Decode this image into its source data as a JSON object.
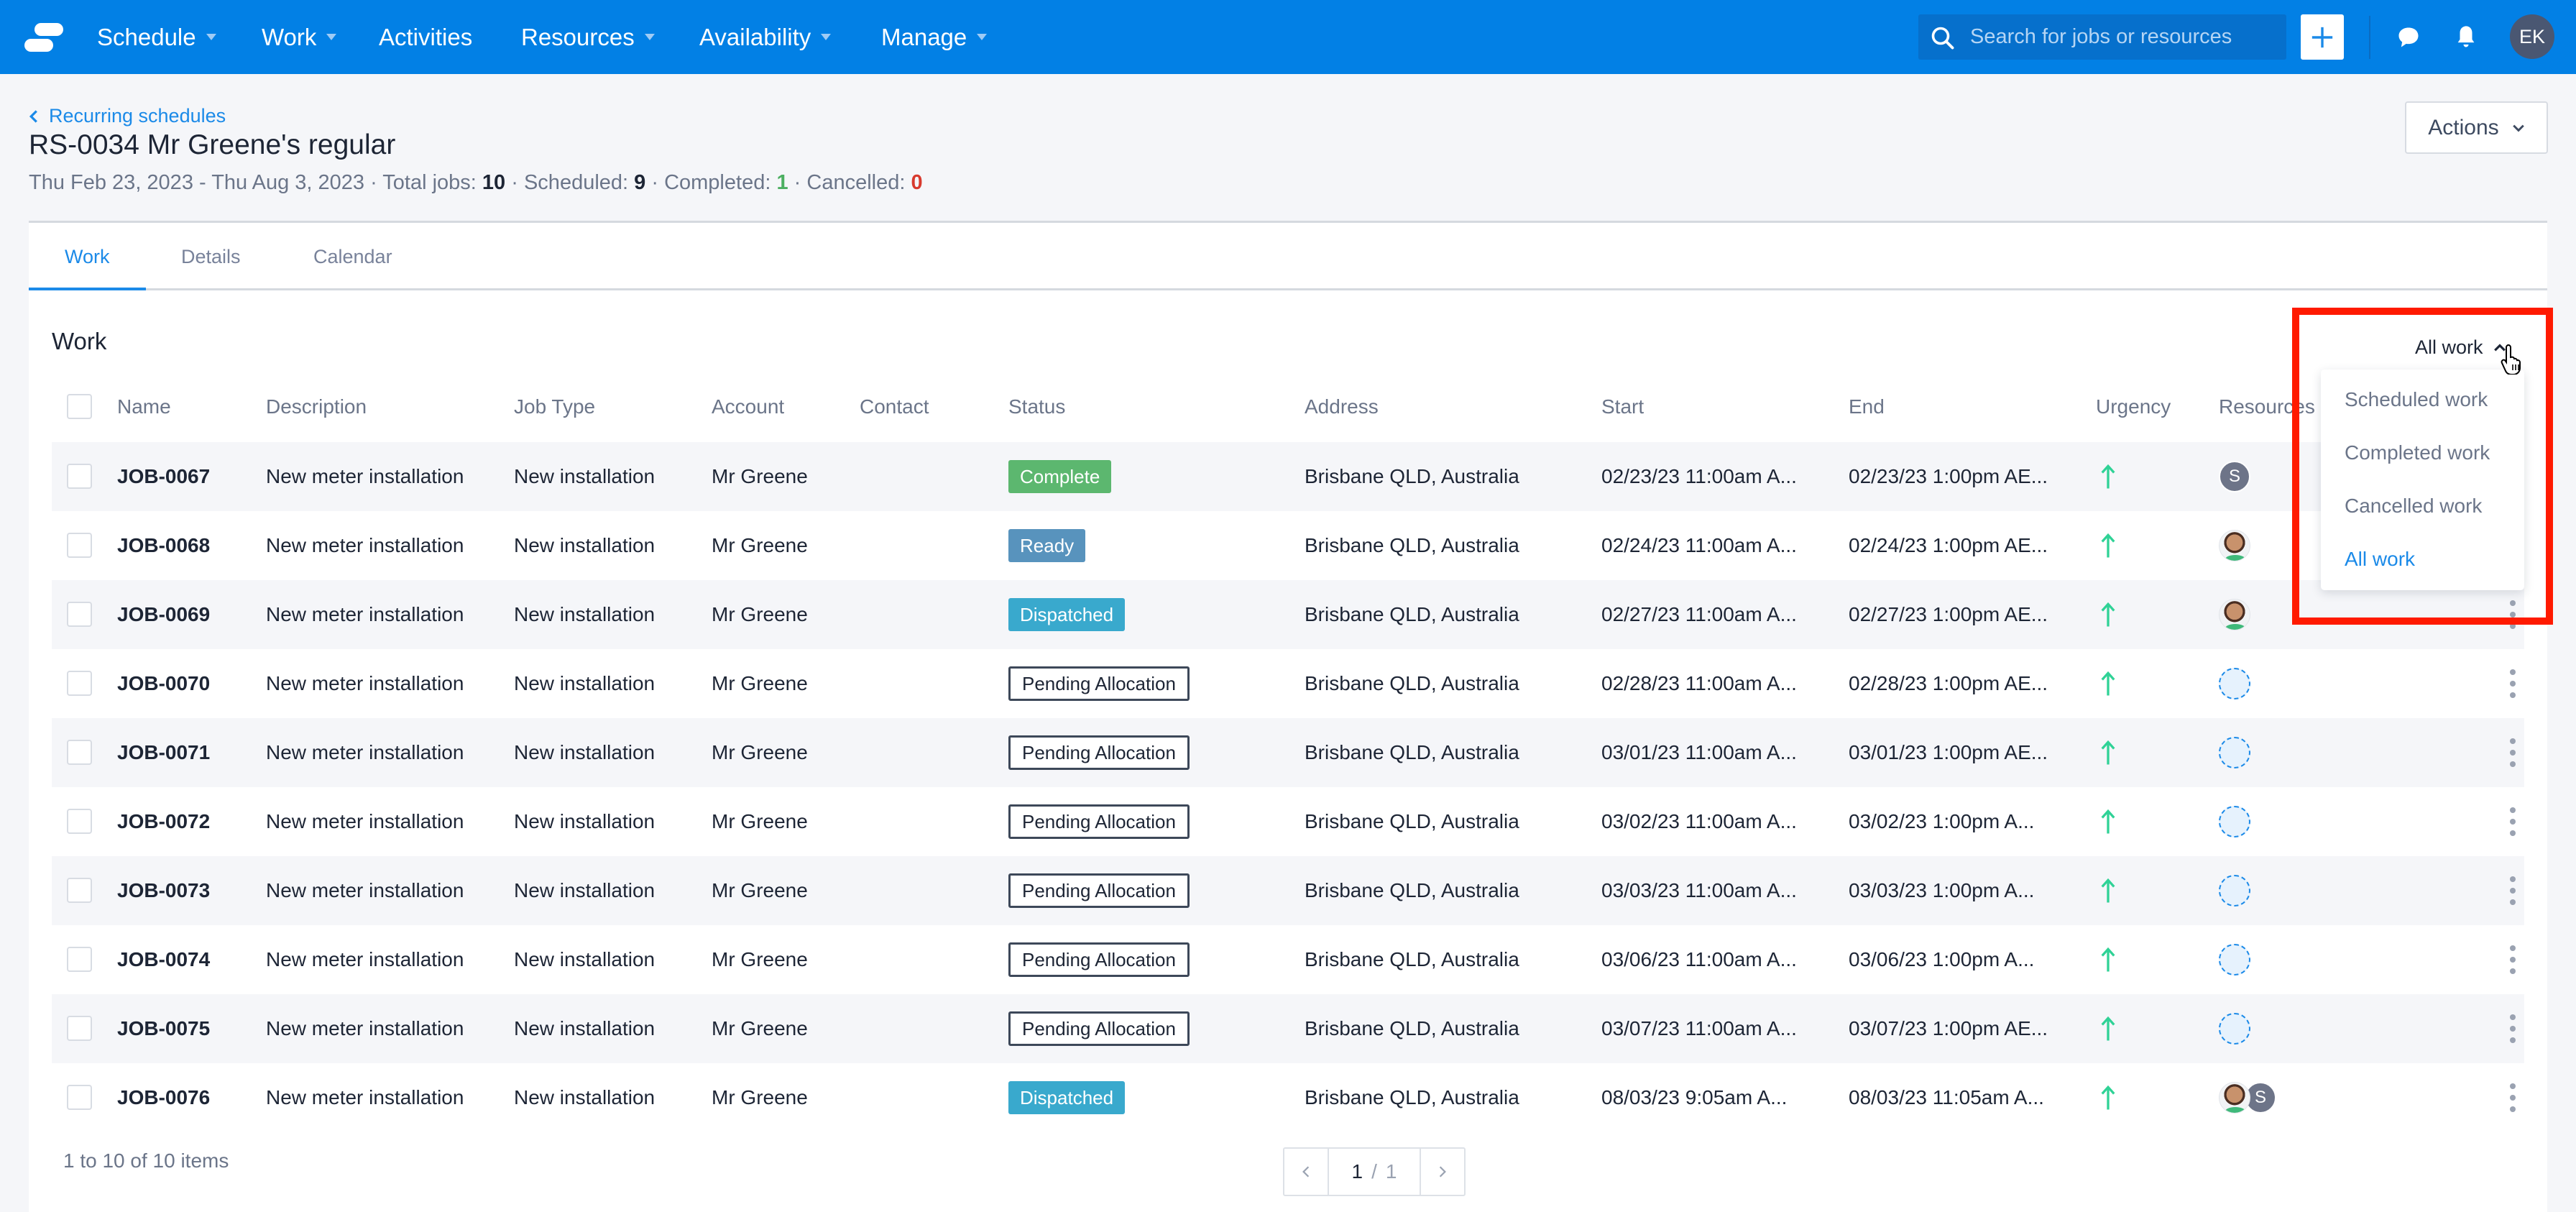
{
  "nav": {
    "items": [
      {
        "label": "Schedule",
        "has_caret": true
      },
      {
        "label": "Work",
        "has_caret": true
      },
      {
        "label": "Activities",
        "has_caret": false
      },
      {
        "label": "Resources",
        "has_caret": true
      },
      {
        "label": "Availability",
        "has_caret": true
      },
      {
        "label": "Manage",
        "has_caret": true
      }
    ],
    "search_placeholder": "Search for jobs or resources",
    "user_initials": "EK",
    "brand_color": "#0280e5"
  },
  "header": {
    "breadcrumb": "Recurring schedules",
    "title": "RS-0034 Mr Greene's regular",
    "date_range": "Thu Feb 23, 2023 - Thu Aug 3, 2023",
    "total_label": "Total jobs:",
    "total_value": "10",
    "scheduled_label": "Scheduled:",
    "scheduled_value": "9",
    "completed_label": "Completed:",
    "completed_value": "1",
    "cancelled_label": "Cancelled:",
    "cancelled_value": "0",
    "actions_label": "Actions"
  },
  "tabs": [
    {
      "label": "Work",
      "active": true
    },
    {
      "label": "Details",
      "active": false
    },
    {
      "label": "Calendar",
      "active": false
    }
  ],
  "section": {
    "title": "Work",
    "filter_label": "All work"
  },
  "table": {
    "columns": [
      "Name",
      "Description",
      "Job Type",
      "Account",
      "Contact",
      "Status",
      "Address",
      "Start",
      "End",
      "Urgency",
      "Resources"
    ],
    "rows": [
      {
        "name": "JOB-0067",
        "description": "New meter installation",
        "job_type": "New installation",
        "account": "Mr Greene",
        "contact": "",
        "status": "Complete",
        "status_kind": "complete",
        "address": "Brisbane QLD, Australia",
        "start": "02/23/23 11:00am A...",
        "end": "02/23/23 1:00pm AE...",
        "urgency": "up-arrow",
        "resources": [
          {
            "type": "initial",
            "label": "S"
          }
        ]
      },
      {
        "name": "JOB-0068",
        "description": "New meter installation",
        "job_type": "New installation",
        "account": "Mr Greene",
        "contact": "",
        "status": "Ready",
        "status_kind": "ready",
        "address": "Brisbane QLD, Australia",
        "start": "02/24/23 11:00am A...",
        "end": "02/24/23 1:00pm AE...",
        "urgency": "up-arrow",
        "resources": [
          {
            "type": "photo",
            "label": ""
          }
        ]
      },
      {
        "name": "JOB-0069",
        "description": "New meter installation",
        "job_type": "New installation",
        "account": "Mr Greene",
        "contact": "",
        "status": "Dispatched",
        "status_kind": "dispatched",
        "address": "Brisbane QLD, Australia",
        "start": "02/27/23 11:00am A...",
        "end": "02/27/23 1:00pm AE...",
        "urgency": "up-arrow",
        "resources": [
          {
            "type": "photo",
            "label": ""
          }
        ]
      },
      {
        "name": "JOB-0070",
        "description": "New meter installation",
        "job_type": "New installation",
        "account": "Mr Greene",
        "contact": "",
        "status": "Pending Allocation",
        "status_kind": "pending",
        "address": "Brisbane QLD, Australia",
        "start": "02/28/23 11:00am A...",
        "end": "02/28/23 1:00pm AE...",
        "urgency": "up-arrow",
        "resources": [
          {
            "type": "empty",
            "label": ""
          }
        ]
      },
      {
        "name": "JOB-0071",
        "description": "New meter installation",
        "job_type": "New installation",
        "account": "Mr Greene",
        "contact": "",
        "status": "Pending Allocation",
        "status_kind": "pending",
        "address": "Brisbane QLD, Australia",
        "start": "03/01/23 11:00am A...",
        "end": "03/01/23 1:00pm AE...",
        "urgency": "up-arrow",
        "resources": [
          {
            "type": "empty",
            "label": ""
          }
        ]
      },
      {
        "name": "JOB-0072",
        "description": "New meter installation",
        "job_type": "New installation",
        "account": "Mr Greene",
        "contact": "",
        "status": "Pending Allocation",
        "status_kind": "pending",
        "address": "Brisbane QLD, Australia",
        "start": "03/02/23 11:00am A...",
        "end": "03/02/23 1:00pm A...",
        "urgency": "up-arrow",
        "resources": [
          {
            "type": "empty",
            "label": ""
          }
        ]
      },
      {
        "name": "JOB-0073",
        "description": "New meter installation",
        "job_type": "New installation",
        "account": "Mr Greene",
        "contact": "",
        "status": "Pending Allocation",
        "status_kind": "pending",
        "address": "Brisbane QLD, Australia",
        "start": "03/03/23 11:00am A...",
        "end": "03/03/23 1:00pm A...",
        "urgency": "up-arrow",
        "resources": [
          {
            "type": "empty",
            "label": ""
          }
        ]
      },
      {
        "name": "JOB-0074",
        "description": "New meter installation",
        "job_type": "New installation",
        "account": "Mr Greene",
        "contact": "",
        "status": "Pending Allocation",
        "status_kind": "pending",
        "address": "Brisbane QLD, Australia",
        "start": "03/06/23 11:00am A...",
        "end": "03/06/23 1:00pm A...",
        "urgency": "up-arrow",
        "resources": [
          {
            "type": "empty",
            "label": ""
          }
        ]
      },
      {
        "name": "JOB-0075",
        "description": "New meter installation",
        "job_type": "New installation",
        "account": "Mr Greene",
        "contact": "",
        "status": "Pending Allocation",
        "status_kind": "pending",
        "address": "Brisbane QLD, Australia",
        "start": "03/07/23 11:00am A...",
        "end": "03/07/23 1:00pm AE...",
        "urgency": "up-arrow",
        "resources": [
          {
            "type": "empty",
            "label": ""
          }
        ]
      },
      {
        "name": "JOB-0076",
        "description": "New meter installation",
        "job_type": "New installation",
        "account": "Mr Greene",
        "contact": "",
        "status": "Dispatched",
        "status_kind": "dispatched",
        "address": "Brisbane QLD, Australia",
        "start": "08/03/23 9:05am A...",
        "end": "08/03/23 11:05am A...",
        "urgency": "up-arrow",
        "resources": [
          {
            "type": "photo",
            "label": ""
          },
          {
            "type": "initial",
            "label": "S"
          }
        ]
      }
    ]
  },
  "pagination": {
    "summary": "1 to 10 of 10 items",
    "current_page": "1",
    "separator": "/",
    "total_pages": "1"
  },
  "filter_dropdown": {
    "options": [
      {
        "label": "Scheduled work",
        "selected": false
      },
      {
        "label": "Completed work",
        "selected": false
      },
      {
        "label": "Cancelled work",
        "selected": false
      },
      {
        "label": "All work",
        "selected": true
      }
    ]
  },
  "colors": {
    "accent": "#1b8ae8",
    "status_complete": "#5cb76f",
    "status_ready": "#5893bd",
    "status_dispatched": "#39a9cd",
    "urgency_arrow": "#2fd296",
    "highlight": "#ff1a00"
  }
}
